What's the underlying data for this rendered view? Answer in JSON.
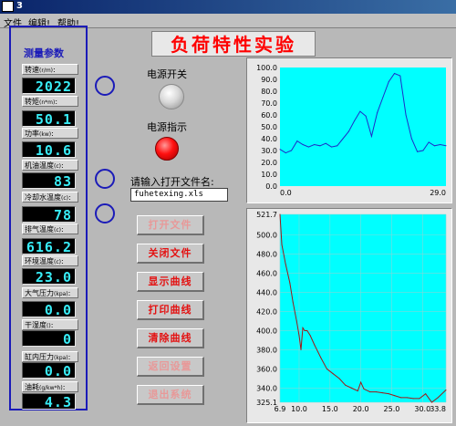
{
  "window": {
    "title": "3"
  },
  "menu": [
    {
      "label": "文件"
    },
    {
      "label": "编辑!"
    },
    {
      "label": "帮助!"
    }
  ],
  "main_title": "负荷特性实验",
  "params_title": "测量参数",
  "params": [
    {
      "label": "转速",
      "unit": "(r/m)",
      "value": "2022"
    },
    {
      "label": "转矩",
      "unit": "(n*m)",
      "value": "50.1"
    },
    {
      "label": "功率",
      "unit": "(kw)",
      "value": "10.6"
    },
    {
      "label": "机油温度",
      "unit": "(c)",
      "value": "83"
    },
    {
      "label": "冷却水温度",
      "unit": "(c)",
      "value": "78"
    },
    {
      "label": "排气温度",
      "unit": "(c)",
      "value": "616.2"
    },
    {
      "label": "环境温度",
      "unit": "(c)",
      "value": "23.0"
    },
    {
      "label": "大气压力",
      "unit": "(kpa)",
      "value": "0.0"
    },
    {
      "label": "干湿度",
      "unit": "()",
      "value": "0"
    },
    {
      "label": "缸内压力",
      "unit": "(kpa)",
      "value": "0.0"
    },
    {
      "label": "油耗",
      "unit": "(g/kw*h)",
      "value": "4.3"
    }
  ],
  "power_switch_label": "电源开关",
  "power_indicator_label": "电源指示",
  "file_prompt": "请输入打开文件名:",
  "file_name": "fuhetexing.xls",
  "buttons": {
    "open": "打开文件",
    "close": "关闭文件",
    "show": "显示曲线",
    "print": "打印曲线",
    "clear": "清除曲线",
    "back": "返回设置",
    "exit": "退出系统"
  },
  "colors": {
    "plot_bg": "#00ffff",
    "plot_line": "#1e2cc8",
    "plot_line2": "#a01818",
    "panel_border": "#1b1bb8",
    "display_text": "#38ecf6",
    "button_text": "#e41010"
  },
  "chart_data": [
    {
      "type": "line",
      "x": [
        0,
        1,
        2,
        3,
        4,
        5,
        6,
        7,
        8,
        9,
        10,
        11,
        12,
        13,
        14,
        15,
        16,
        17,
        18,
        19,
        20,
        21,
        22,
        23,
        24,
        25,
        26,
        27,
        28,
        29
      ],
      "y": [
        31,
        28,
        30,
        38,
        35,
        33,
        35,
        34,
        36,
        33,
        34,
        40,
        46,
        55,
        63,
        59,
        42,
        62,
        75,
        88,
        95,
        93,
        60,
        40,
        29,
        30,
        37,
        34,
        35,
        34
      ],
      "xlim": [
        0,
        29
      ],
      "ylim": [
        0,
        100
      ],
      "yticks": [
        "100.0",
        "90.0",
        "80.0",
        "70.0",
        "60.0",
        "50.0",
        "40.0",
        "30.0",
        "20.0",
        "10.0",
        "0.0"
      ],
      "xticks": [
        "0.0",
        "29.0"
      ],
      "grid": false
    },
    {
      "type": "line",
      "x": [
        6.9,
        7.2,
        7.8,
        8.5,
        9.0,
        9.6,
        10.0,
        10.3,
        10.6,
        10.9,
        11.3,
        11.8,
        12.5,
        13.5,
        14.5,
        15.5,
        16.5,
        17.5,
        18.5,
        19.5,
        20.0,
        20.5,
        21.5,
        22.5,
        23.5,
        24.5,
        25.5,
        26.5,
        27.5,
        28.5,
        29.5,
        30.5,
        31.5,
        32.5,
        33.8
      ],
      "y": [
        521.7,
        490,
        470,
        450,
        430,
        410,
        395,
        380,
        403,
        400,
        400,
        395,
        385,
        372,
        360,
        355,
        350,
        343,
        340,
        337,
        346,
        339,
        336,
        336,
        335,
        334,
        332,
        330,
        330,
        329,
        329,
        334,
        325.1,
        330,
        338
      ],
      "xlim": [
        6.9,
        33.8
      ],
      "ylim": [
        325.1,
        521.7
      ],
      "yticks": [
        "521.7",
        "500.0",
        "480.0",
        "460.0",
        "440.0",
        "420.0",
        "400.0",
        "380.0",
        "360.0",
        "340.0",
        "325.1"
      ],
      "xticks": [
        "6.9",
        "10.0",
        "15.0",
        "20.0",
        "25.0",
        "30.0",
        "33.8"
      ],
      "grid": true
    }
  ]
}
